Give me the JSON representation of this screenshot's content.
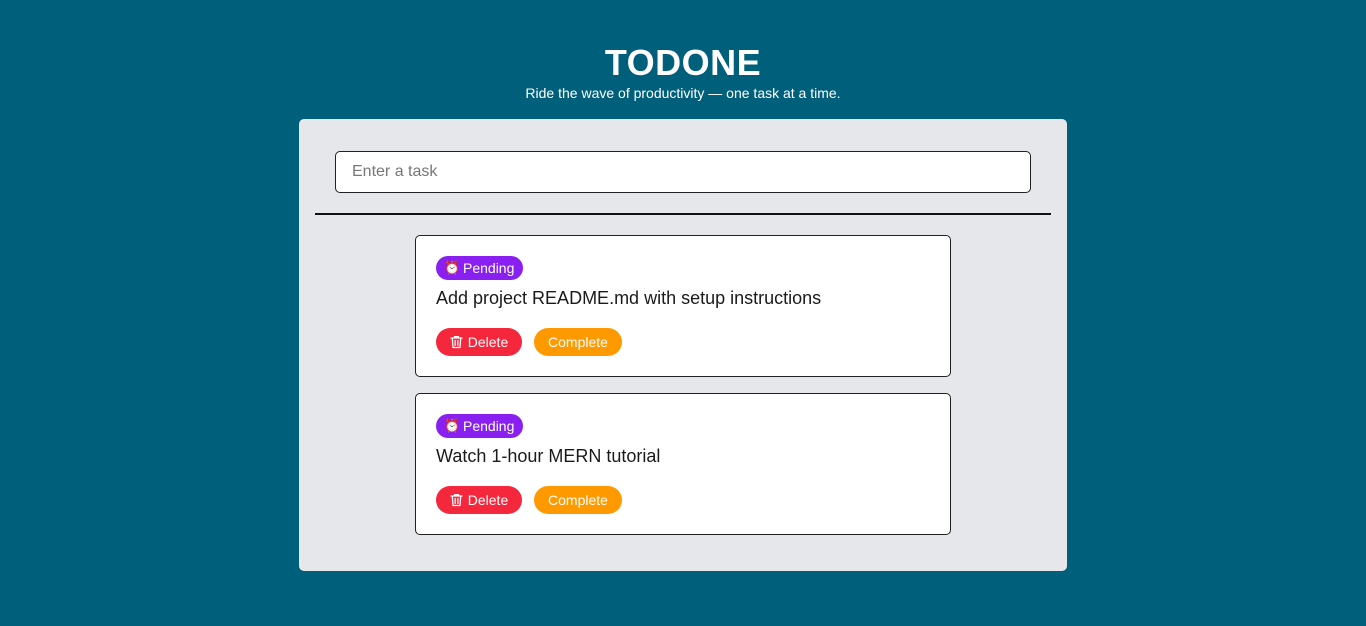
{
  "app": {
    "title": "TODONE",
    "subtitle": "Ride the wave of productivity — one task at a time."
  },
  "input": {
    "placeholder": "Enter a task",
    "value": ""
  },
  "tasks": [
    {
      "status": "Pending",
      "status_icon": "alarm-clock-icon",
      "text": "Add project README.md with setup instructions",
      "delete_label": "Delete",
      "complete_label": "Complete"
    },
    {
      "status": "Pending",
      "status_icon": "alarm-clock-icon",
      "text": "Watch 1-hour MERN tutorial",
      "delete_label": "Delete",
      "complete_label": "Complete"
    }
  ],
  "colors": {
    "background": "#005f7a",
    "panel": "#e5e7eb",
    "pending_badge": "#8a1ff2",
    "delete_button": "#f5273d",
    "complete_button": "#ff9900"
  }
}
